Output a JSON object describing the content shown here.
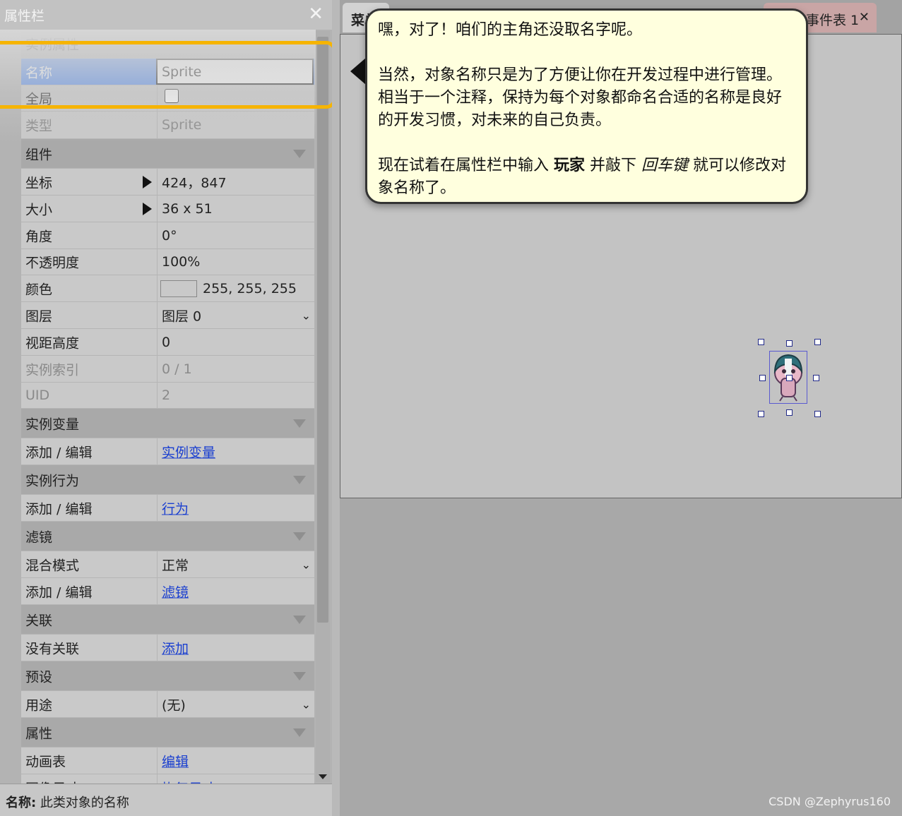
{
  "panel": {
    "title": "属性栏",
    "close_icon": "close-icon",
    "rows": {
      "instance_props": "实例属性",
      "name_label": "名称",
      "name_value": "Sprite",
      "global_label": "全局",
      "type_label": "类型",
      "type_value": "Sprite",
      "components": "组件",
      "position_label": "坐标",
      "position_value": "424，847",
      "size_label": "大小",
      "size_value": "36 x 51",
      "angle_label": "角度",
      "angle_value": "0°",
      "opacity_label": "不透明度",
      "opacity_value": "100%",
      "color_label": "颜色",
      "color_value": "255, 255, 255",
      "layer_label": "图层",
      "layer_value": "图层 0",
      "zelevation_label": "视距高度",
      "zelevation_value": "0",
      "index_label": "实例索引",
      "index_value": "0 / 1",
      "uid_label": "UID",
      "uid_value": "2",
      "instvars": "实例变量",
      "instvars_label": "添加 / 编辑",
      "instvars_link": "实例变量",
      "behaviors": "实例行为",
      "behaviors_label": "添加 / 编辑",
      "behaviors_link": "行为",
      "effects": "滤镜",
      "blend_label": "混合模式",
      "blend_value": "正常",
      "effects_label": "添加 / 编辑",
      "effects_link": "滤镜",
      "hierarchy": "关联",
      "hierarchy_label": "没有关联",
      "hierarchy_link": "添加",
      "templates": "预设",
      "template_label": "用途",
      "template_value": "(无)",
      "properties": "属性",
      "animations_label": "动画表",
      "animations_link": "编辑",
      "partial_label": "图像尺寸",
      "partial_link": "恢复尺寸"
    }
  },
  "status": {
    "bold": "名称:",
    "text": " 此类对象的名称"
  },
  "tabs": {
    "tab1": "菜单",
    "tab2": "事件表 1"
  },
  "tooltip": {
    "line1": "嘿，对了！咱们的主角还没取名字呢。",
    "line2": "当然，对象名称只是为了方便让你在开发过程中进行管理。相当于一个注释，保持为每个对象都命名合适的名称是良好的开发习惯，对未来的自己负责。",
    "line3_a": "现在试着在属性栏中输入 ",
    "line3_b": "玩家",
    "line3_c": " 并敲下 ",
    "line3_d": "回车键",
    "line3_e": " 就可以修改对象名称了。"
  },
  "watermark": "CSDN @Zephyrus160",
  "colors": {
    "highlight": "#f6b400",
    "selected_row": "#4a86f0",
    "tooltip_bg": "#ffffde",
    "link": "#1a3fd0"
  }
}
